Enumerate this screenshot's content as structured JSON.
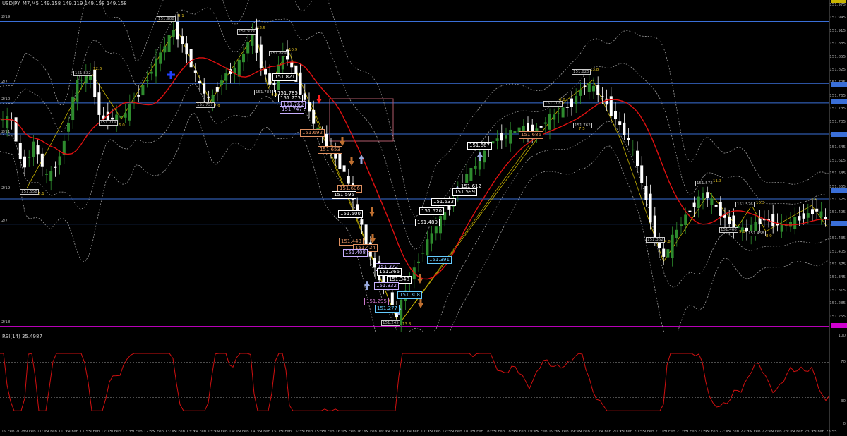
{
  "window": {
    "header_text": "USDJPY_M7,M5  149.158 149.119 149.158 149.158",
    "rsi_header": "RSI(14) 35.4987"
  },
  "side_labels": [
    "2/19",
    "2/7",
    "2/10",
    "2/11",
    "2/19",
    "2/7",
    "2/18"
  ],
  "price_axis": [
    "151.975",
    "151.945",
    "151.915",
    "151.885",
    "151.855",
    "151.825",
    "151.795",
    "151.765",
    "151.735",
    "151.705",
    "151.675",
    "151.645",
    "151.615",
    "151.585",
    "151.555",
    "151.525",
    "151.495",
    "151.465",
    "151.435",
    "151.405",
    "151.375",
    "151.345",
    "151.315",
    "151.285",
    "151.255"
  ],
  "rsi_axis": [
    "100",
    "70",
    "30",
    "0"
  ],
  "time_axis": [
    "19 Feb 2025",
    "19 Feb 11:15",
    "19 Feb 11:35",
    "19 Feb 11:55",
    "19 Feb 12:15",
    "19 Feb 12:35",
    "19 Feb 12:55",
    "19 Feb 13:15",
    "19 Feb 13:35",
    "19 Feb 13:55",
    "19 Feb 14:15",
    "19 Feb 14:35",
    "19 Feb 15:15",
    "19 Feb 15:35",
    "19 Feb 15:55",
    "19 Feb 16:15",
    "19 Feb 16:35",
    "19 Feb 16:55",
    "19 Feb 17:15",
    "19 Feb 17:35",
    "19 Feb 17:55",
    "19 Feb 18:15",
    "19 Feb 18:35",
    "19 Feb 18:55",
    "19 Feb 19:15",
    "19 Feb 19:35",
    "19 Feb 19:55",
    "19 Feb 20:15",
    "19 Feb 20:35",
    "19 Feb 20:55",
    "19 Feb 21:15",
    "19 Feb 21:35",
    "19 Feb 21:55",
    "19 Feb 22:15",
    "19 Feb 22:35",
    "19 Feb 22:55",
    "19 Feb 23:15",
    "19 Feb 23:35",
    "19 Feb 23:55"
  ],
  "price_labels": [
    "151.558",
    "151.832",
    "151.719",
    "151.908",
    "151.939",
    "151.757",
    "151.879",
    "151.784",
    "151.785",
    "151.821",
    "151.773",
    "151.760",
    "151.747",
    "151.692",
    "151.653",
    "151.606",
    "151.595",
    "151.500",
    "151.448",
    "151.424",
    "151.408",
    "151.372",
    "151.366",
    "151.348",
    "151.332",
    "151.308",
    "151.295",
    "151.277",
    "151.245",
    "151.480",
    "151.520",
    "151.533",
    "151.391",
    "151.612",
    "151.599",
    "151.667",
    "151.686",
    "151.708",
    "151.825",
    "151.762",
    "151.572",
    "151.526",
    "151.466",
    "151.458",
    "151.362"
  ],
  "zigzag_labels": [
    "6.1",
    "12.6",
    "6.0",
    "9.1",
    "12.5",
    "7.9",
    "10.9",
    "4.8",
    "13.3",
    "6.8",
    "7.5",
    "13.8",
    "4.8",
    "11.3",
    "10.3",
    "9.6",
    "8.9",
    "14.1"
  ],
  "colors": {
    "bg": "#000000",
    "bull": "#2e8b2e",
    "bear": "#ffffff",
    "ma": "#e01010",
    "band": "#9a9a9a",
    "hline": "#3a6fd8",
    "magenta": "#d000d0",
    "zigzag": "#c8b400",
    "rsi": "#d01010"
  }
}
